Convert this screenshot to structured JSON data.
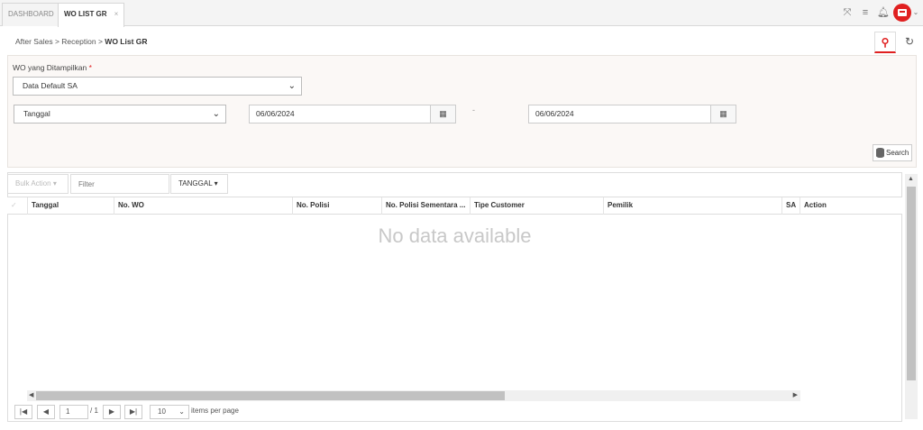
{
  "tabs": [
    {
      "label": "DASHBOARD",
      "active": false
    },
    {
      "label": "WO LIST GR",
      "active": true,
      "close": "×"
    }
  ],
  "topbar_icons": [
    "expand-icon",
    "menu-icon",
    "bell-icon",
    "avatar",
    "chevron-down-icon"
  ],
  "breadcrumb": {
    "parts": [
      "After Sales",
      "Reception"
    ],
    "current": "WO List GR",
    "separator": ">"
  },
  "filter": {
    "label": "WO yang Ditampilkan",
    "required": "*",
    "wo_select": "Data Default SA",
    "date_type": "Tanggal",
    "date_from": "06/06/2024",
    "date_to": "06/06/2024",
    "range_sep": "-",
    "search_label": "Search"
  },
  "toolbar": {
    "bulk_action": "Bulk Action",
    "filter_placeholder": "Filter",
    "sort_label": "TANGGAL"
  },
  "table": {
    "columns": [
      "Tanggal",
      "No. WO",
      "No. Polisi",
      "No. Polisi Sementara ...",
      "Tipe Customer",
      "Pemilik",
      "SA",
      "Action"
    ],
    "empty_text": "No data available"
  },
  "pager": {
    "page": "1",
    "of_text": "/ 1",
    "per_page": "10",
    "per_page_label": "items per page"
  },
  "colors": {
    "accent": "#e02020"
  }
}
